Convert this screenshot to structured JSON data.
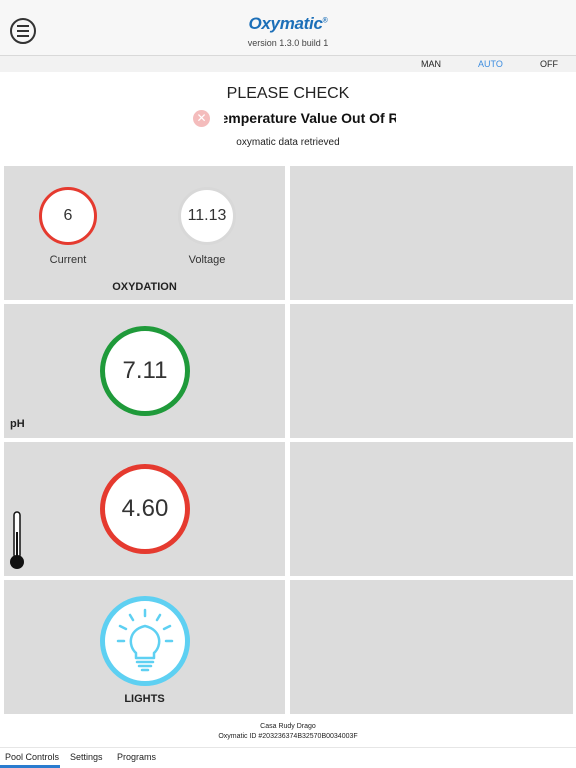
{
  "header": {
    "logo_text": "Oxymatic",
    "logo_reg": "®",
    "version": "version 1.3.0 build 1",
    "menu_icon": "hamburger-circle-icon"
  },
  "modes": {
    "man": "MAN",
    "auto": "AUTO",
    "off": "OFF",
    "active": "AUTO",
    "active_color": "#3d8de0"
  },
  "status": {
    "title": "PLEASE CHECK",
    "alert": "Temperature Value Out Of Range",
    "alert_icon": "error-x-icon",
    "message": "oxymatic data retrieved"
  },
  "oxydation": {
    "current_value": "6",
    "current_label": "Current",
    "voltage_value": "11.13",
    "voltage_label": "Voltage",
    "title": "OXYDATION",
    "current_ring_color": "#e53a2f",
    "voltage_ring_color": "#d8d8d8"
  },
  "ph": {
    "value": "7.11",
    "label": "pH",
    "ring_color": "#1f9a3a"
  },
  "temperature": {
    "value": "4.60",
    "icon": "thermometer-icon",
    "ring_color": "#e53a2f"
  },
  "lights": {
    "label": "LIGHTS",
    "icon": "lightbulb-icon",
    "ring_color": "#5ed0f2"
  },
  "footer": {
    "name": "Casa Rudy Drago",
    "oxymatic_id": "Oxymatic ID #203236374B32570B0034003F"
  },
  "tabs": {
    "pool_controls": "Pool Controls",
    "settings": "Settings",
    "programs": "Programs",
    "active": "Pool Controls",
    "accent": "#2a7ccf"
  }
}
